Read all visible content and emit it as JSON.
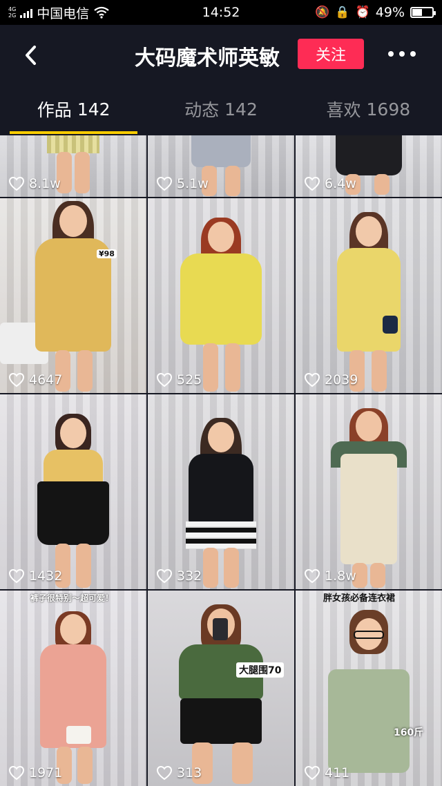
{
  "status_bar": {
    "network_top": "4G",
    "network_bottom": "2G",
    "carrier": "中国电信",
    "time": "14:52",
    "battery": "49%",
    "battery_level": 0.49
  },
  "header": {
    "title": "大码魔术师英敏",
    "follow_label": "关注"
  },
  "tabs": [
    {
      "label": "作品",
      "count": "142",
      "active": true
    },
    {
      "label": "动态",
      "count": "142",
      "active": false
    },
    {
      "label": "喜欢",
      "count": "1698",
      "active": false
    }
  ],
  "videos": [
    {
      "likes": "8.1w"
    },
    {
      "likes": "5.1w"
    },
    {
      "likes": "6.4w"
    },
    {
      "likes": "4647",
      "overlay": "¥98"
    },
    {
      "likes": "525"
    },
    {
      "likes": "2039"
    },
    {
      "likes": "1432"
    },
    {
      "likes": "332"
    },
    {
      "likes": "1.8w"
    },
    {
      "likes": "1971",
      "overlay": "裤子很特别～超可爱！"
    },
    {
      "likes": "313",
      "overlay": "大腿围70"
    },
    {
      "likes": "411",
      "overlay": "胖女孩必备连衣裙",
      "overlay2": "160斤"
    }
  ]
}
